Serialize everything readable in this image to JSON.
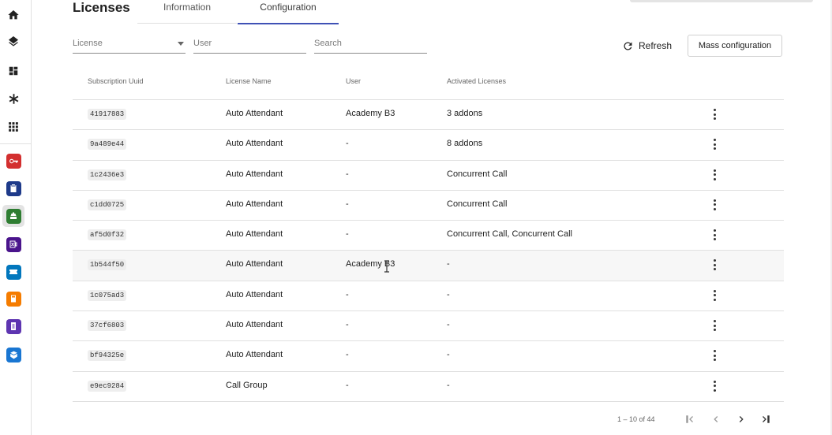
{
  "page": {
    "title": "Licenses"
  },
  "tabs": [
    {
      "label": "Information",
      "active": false
    },
    {
      "label": "Configuration",
      "active": true
    }
  ],
  "colors": {
    "accent": "#3f51b5"
  },
  "sidebar": {
    "nav": [
      "home-icon",
      "layers-icon",
      "dashboard-icon",
      "asterisk-icon",
      "apps-grid-icon"
    ],
    "apps": [
      {
        "name": "key-app-icon",
        "color": "#d32f2f"
      },
      {
        "name": "clipboard-app-icon",
        "color": "#1e3a8a"
      },
      {
        "name": "switchboard-app-icon",
        "color": "#2e7d32",
        "active": true
      },
      {
        "name": "fax-app-icon",
        "color": "#4a148c"
      },
      {
        "name": "ticket-app-icon",
        "color": "#0277bd"
      },
      {
        "name": "calculator-app-icon",
        "color": "#f57c00"
      },
      {
        "name": "notebook-app-icon",
        "color": "#5e35b1"
      },
      {
        "name": "box-app-icon",
        "color": "#1976d2"
      }
    ]
  },
  "filters": {
    "license_label": "License",
    "user_label": "User",
    "search_label": "Search"
  },
  "actions": {
    "refresh_label": "Refresh",
    "mass_label": "Mass configuration"
  },
  "table": {
    "headers": [
      "Subscription Uuid",
      "License Name",
      "User",
      "Activated Licenses"
    ],
    "rows": [
      {
        "uuid": "41917883",
        "name": "Auto Attendant",
        "user": "Academy B3",
        "activated": "3 addons"
      },
      {
        "uuid": "9a489e44",
        "name": "Auto Attendant",
        "user": "-",
        "activated": "8 addons"
      },
      {
        "uuid": "1c2436e3",
        "name": "Auto Attendant",
        "user": "-",
        "activated": "Concurrent Call"
      },
      {
        "uuid": "c1dd0725",
        "name": "Auto Attendant",
        "user": "-",
        "activated": "Concurrent Call"
      },
      {
        "uuid": "af5d0f32",
        "name": "Auto Attendant",
        "user": "-",
        "activated": "Concurrent Call, Concurrent Call"
      },
      {
        "uuid": "1b544f50",
        "name": "Auto Attendant",
        "user": "Academy B3",
        "activated": "-",
        "highlighted": true
      },
      {
        "uuid": "1c075ad3",
        "name": "Auto Attendant",
        "user": "-",
        "activated": "-"
      },
      {
        "uuid": "37cf6803",
        "name": "Auto Attendant",
        "user": "-",
        "activated": "-"
      },
      {
        "uuid": "bf94325e",
        "name": "Auto Attendant",
        "user": "-",
        "activated": "-"
      },
      {
        "uuid": "e9ec9284",
        "name": "Call Group",
        "user": "-",
        "activated": "-"
      }
    ]
  },
  "pagination": {
    "range_label": "1 – 10 of 44",
    "controls": [
      "first-page-icon",
      "prev-page-icon",
      "next-page-icon",
      "last-page-icon"
    ]
  }
}
